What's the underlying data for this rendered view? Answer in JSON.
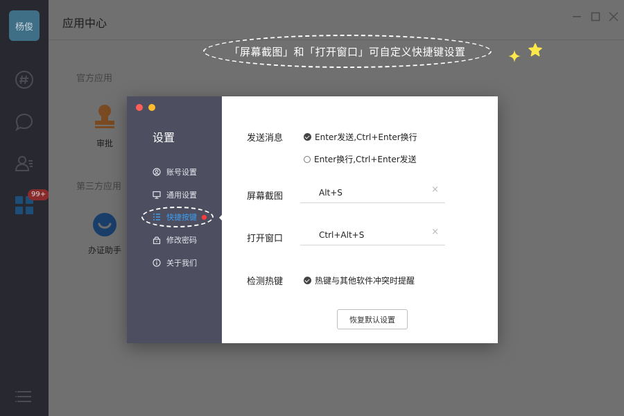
{
  "rail": {
    "avatar_text": "杨俊",
    "badge": "99+"
  },
  "main": {
    "title": "应用中心",
    "official_section": "官方应用",
    "third_party_section": "第三方应用",
    "apps": {
      "approval": "审批",
      "zheng_assistant": "办证助手"
    }
  },
  "callout": {
    "text": "「屏幕截图」和「打开窗口」可自定义快捷键设置"
  },
  "dialog": {
    "title": "设置",
    "nav": [
      {
        "label": "账号设置",
        "icon": "account-icon"
      },
      {
        "label": "通用设置",
        "icon": "monitor-icon"
      },
      {
        "label": "快捷按键",
        "icon": "shortcut-icon",
        "active": true
      },
      {
        "label": "修改密码",
        "icon": "lock-icon"
      },
      {
        "label": "关于我们",
        "icon": "info-icon"
      }
    ],
    "send_message_label": "发送消息",
    "send_options": [
      {
        "label": "Enter发送,Ctrl+Enter换行",
        "checked": true
      },
      {
        "label": "Enter换行,Ctrl+Enter发送",
        "checked": false
      }
    ],
    "screenshot_label": "屏幕截图",
    "screenshot_hotkey": "Alt+S",
    "open_window_label": "打开窗口",
    "open_window_hotkey": "Ctrl+Alt+S",
    "detect_label": "检测热键",
    "detect_option": "热键与其他软件冲突时提醒",
    "reset_button": "恢复默认设置",
    "clear_glyph": "×"
  },
  "colors": {
    "accent": "#3c9ef2",
    "sidebar": "#4d4e60",
    "notification_dot": "#ff3b3b",
    "traffic_red": "#ff5f56",
    "traffic_yellow": "#ffbd2e",
    "sparkle": "#ffe94a"
  }
}
